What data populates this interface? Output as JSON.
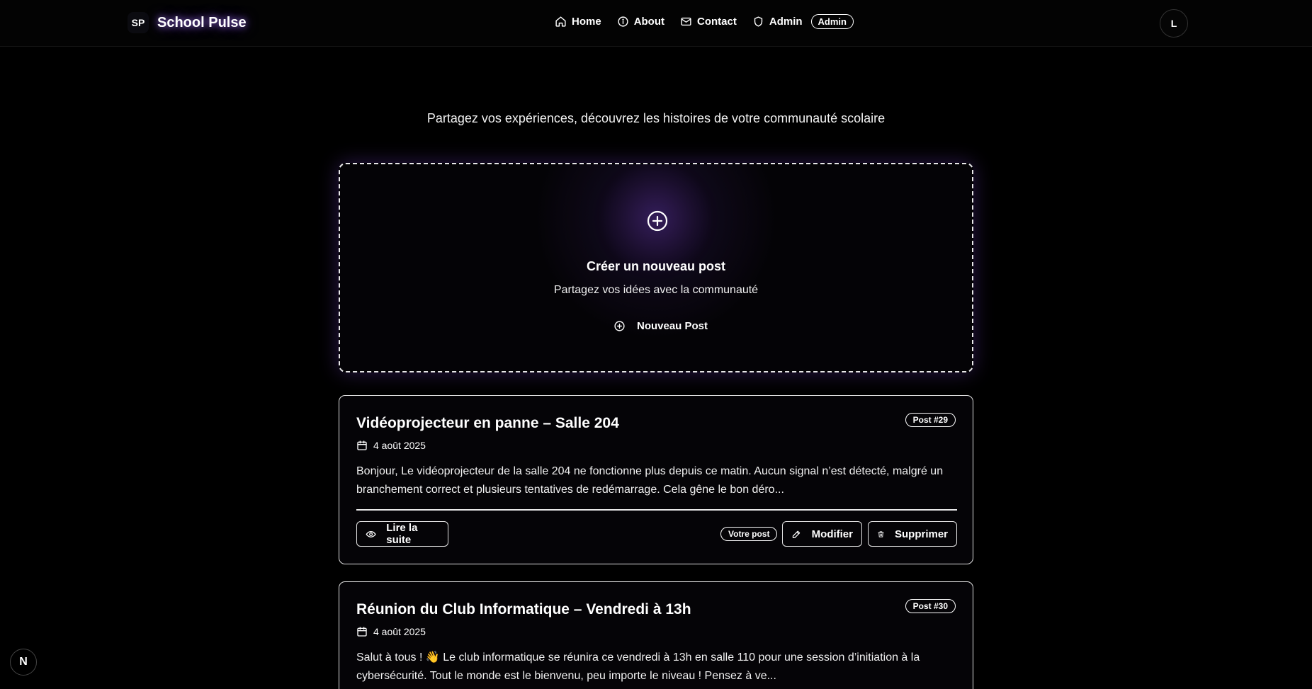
{
  "header": {
    "logo_badge": "SP",
    "app_name": "School Pulse",
    "nav": [
      {
        "label": "Home",
        "icon": "home-icon"
      },
      {
        "label": "About",
        "icon": "info-icon"
      },
      {
        "label": "Contact",
        "icon": "mail-icon"
      },
      {
        "label": "Admin",
        "icon": "shield-icon"
      }
    ],
    "admin_badge": "Admin",
    "avatar_letter": "L"
  },
  "hero": {
    "tagline": "Partagez vos expériences, découvrez les histoires de votre communauté scolaire"
  },
  "create_card": {
    "title": "Créer un nouveau post",
    "subtitle": "Partagez vos idées avec la communauté",
    "button_label": "Nouveau Post"
  },
  "posts": [
    {
      "title": "Vidéoprojecteur en panne – Salle 204",
      "badge": "Post #29",
      "date": "4 août 2025",
      "excerpt": "Bonjour, Le vidéoprojecteur de la salle 204 ne fonctionne plus depuis ce matin. Aucun signal n’est détecté, malgré un branchement correct et plusieurs tentatives de redémarrage. Cela gêne le bon déro...",
      "read_label": "Lire la suite",
      "own_tag": "Votre post",
      "edit_label": "Modifier",
      "delete_label": "Supprimer"
    },
    {
      "title": "Réunion du Club Informatique – Vendredi à 13h",
      "badge": "Post #30",
      "date": "4 août 2025",
      "excerpt": "Salut à tous ! 👋 Le club informatique se réunira ce vendredi à 13h en salle 110 pour une session d’initiation à la cybersécurité. Tout le monde est le bienvenu, peu importe le niveau ! Pensez à ve..."
    }
  ],
  "dev_indicator": "N",
  "colors": {
    "background": "#000000",
    "accent_glow": "#8c5af0",
    "text": "#ffffff"
  }
}
